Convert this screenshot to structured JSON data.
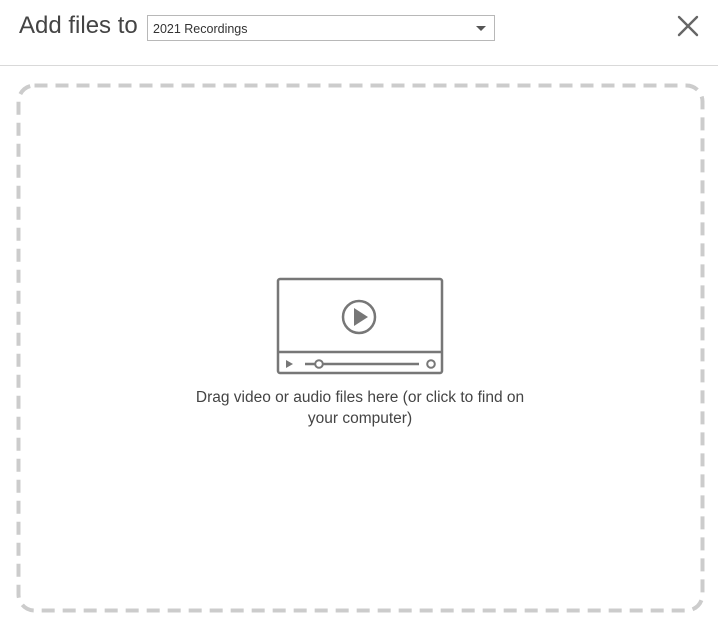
{
  "header": {
    "title": "Add files to",
    "folder_select": {
      "selected_value": "2021 Recordings"
    },
    "close_icon": "close-icon"
  },
  "dropzone": {
    "icon": "video-player-icon",
    "instruction": "Drag video or audio files here (or click to find on your computer)"
  },
  "colors": {
    "text": "#444444",
    "border_dashed": "#cccccc",
    "icon": "#777777",
    "divider": "#d9d9d9"
  }
}
